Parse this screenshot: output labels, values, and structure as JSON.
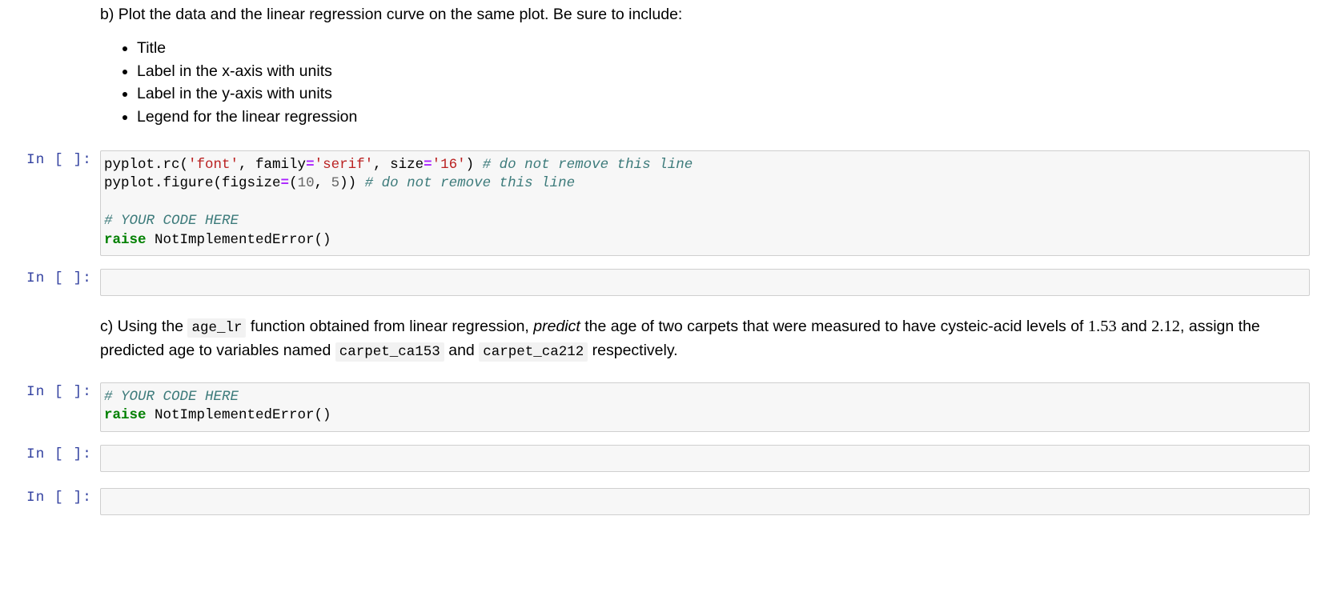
{
  "markdown_b": {
    "intro": "b) Plot the data and the linear regression curve on the same plot. Be sure to include:",
    "bullets": [
      "Title",
      "Label in the x-axis with units",
      "Label in the y-axis with units",
      "Legend for the linear regression"
    ]
  },
  "markdown_c": {
    "seg1": "c) Using the",
    "code1": "age_lr",
    "seg2": "function obtained from linear regression,",
    "emphasis": "predict",
    "seg3": "the age of two carpets that were measured to have cysteic-acid levels of",
    "num1": "1.53",
    "seg4": "and",
    "num2": "2.12",
    "seg5": ", assign the predicted age to variables named",
    "code2": "carpet_ca153",
    "seg6": "and",
    "code3": "carpet_ca212",
    "seg7": "respectively."
  },
  "cells": [
    {
      "prompt": "In [ ]:",
      "lines": [
        [
          {
            "t": "pyplot.rc(",
            "c": "plain"
          },
          {
            "t": "'font'",
            "c": "str"
          },
          {
            "t": ", family",
            "c": "plain"
          },
          {
            "t": "=",
            "c": "op"
          },
          {
            "t": "'serif'",
            "c": "str"
          },
          {
            "t": ", size",
            "c": "plain"
          },
          {
            "t": "=",
            "c": "op"
          },
          {
            "t": "'16'",
            "c": "str"
          },
          {
            "t": ") ",
            "c": "plain"
          },
          {
            "t": "# do not remove this line",
            "c": "com"
          }
        ],
        [
          {
            "t": "pyplot.figure(figsize",
            "c": "plain"
          },
          {
            "t": "=",
            "c": "op"
          },
          {
            "t": "(",
            "c": "plain"
          },
          {
            "t": "10",
            "c": "num"
          },
          {
            "t": ", ",
            "c": "plain"
          },
          {
            "t": "5",
            "c": "num"
          },
          {
            "t": ")) ",
            "c": "plain"
          },
          {
            "t": "# do not remove this line",
            "c": "com"
          }
        ],
        [],
        [
          {
            "t": "# YOUR CODE HERE",
            "c": "com"
          }
        ],
        [
          {
            "t": "raise",
            "c": "kw"
          },
          {
            "t": " NotImplementedError()",
            "c": "plain"
          }
        ]
      ]
    },
    {
      "prompt": "In [ ]:",
      "lines": []
    },
    {
      "prompt": "In [ ]:",
      "lines": [
        [
          {
            "t": "# YOUR CODE HERE",
            "c": "com"
          }
        ],
        [
          {
            "t": "raise",
            "c": "kw"
          },
          {
            "t": " NotImplementedError()",
            "c": "plain"
          }
        ]
      ]
    },
    {
      "prompt": "In [ ]:",
      "lines": []
    },
    {
      "prompt": "In [ ]:",
      "lines": []
    }
  ],
  "colors": {
    "prompt": "#303F9F",
    "cell_bg": "#f7f7f7",
    "cell_border": "#cfcfcf",
    "string": "#BA2121",
    "operator": "#AA22FF",
    "comment": "#3D7B7B",
    "keyword": "#008000",
    "number": "#666666",
    "inline_code_bg": "#f2f2f2"
  }
}
